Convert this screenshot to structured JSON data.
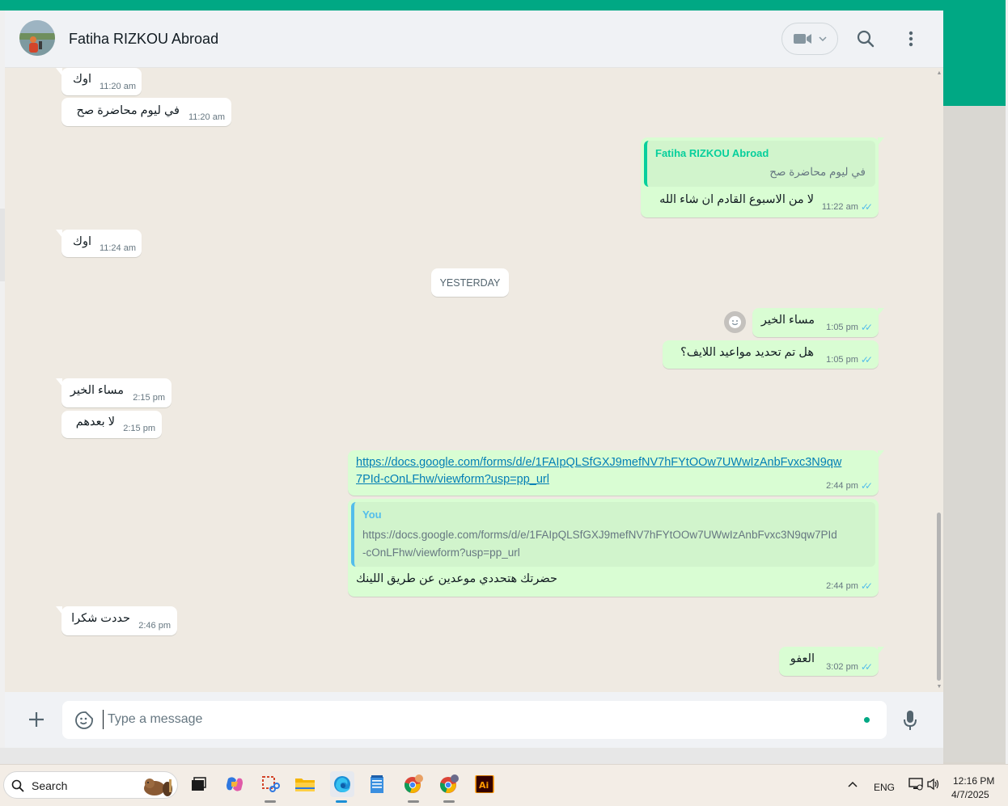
{
  "header": {
    "contact_name": "Fatiha RIZKOU Abroad"
  },
  "messages": {
    "m1": {
      "text": "اوك",
      "time": "11:20 am"
    },
    "m2": {
      "text": "في ليوم محاضرة صح",
      "time": "11:20 am"
    },
    "m3": {
      "quote_author": "Fatiha RIZKOU Abroad",
      "quote_text": "في ليوم محاضرة صح",
      "text": "لا من الاسبوع القادم ان شاء الله",
      "time": "11:22 am"
    },
    "m4": {
      "text": "اوك",
      "time": "11:24 am"
    },
    "date_separator": "YESTERDAY",
    "m5": {
      "text": "مساء الخير",
      "time": "1:05 pm"
    },
    "m6": {
      "text": "هل تم تحديد مواعيد اللايف؟",
      "time": "1:05 pm"
    },
    "m7": {
      "text": "مساء الخير",
      "time": "2:15 pm"
    },
    "m8": {
      "text": "لا بعدهم",
      "time": "2:15 pm"
    },
    "m9": {
      "link_line1": "https://docs.google.com/forms/d/e/1FAIpQLSfGXJ9mefNV7hFYtOOw7UWwIzAnbFvxc3N9qw",
      "link_line2": "7PId-cOnLFhw/viewform?usp=pp_url",
      "time": "2:44 pm"
    },
    "m10": {
      "quote_author": "You",
      "quote_line1": "https://docs.google.com/forms/d/e/1FAIpQLSfGXJ9mefNV7hFYtOOw7UWwIzAnbFvxc3N9qw7PId",
      "quote_line2": "-cOnLFhw/viewform?usp=pp_url",
      "text": "حضرتك هتحددي موعدين عن طريق اللينك",
      "time": "2:44 pm"
    },
    "m11": {
      "text": "حددت شكرا",
      "time": "2:46 pm"
    },
    "m12": {
      "text": "العفو",
      "time": "3:02 pm"
    }
  },
  "composer": {
    "placeholder": "Type a message"
  },
  "taskbar": {
    "search_label": "Search",
    "language": "ENG",
    "time": "12:16 PM",
    "date": "4/7/2025"
  },
  "colors": {
    "brand_green": "#00a884",
    "incoming_bubble": "#ffffff",
    "outgoing_bubble": "#d9fdd3",
    "chat_background": "#efeae2",
    "read_ticks": "#53bdeb",
    "link": "#027eb5",
    "quote_author_other": "#06cf9c",
    "quote_author_you": "#53bdeb"
  }
}
